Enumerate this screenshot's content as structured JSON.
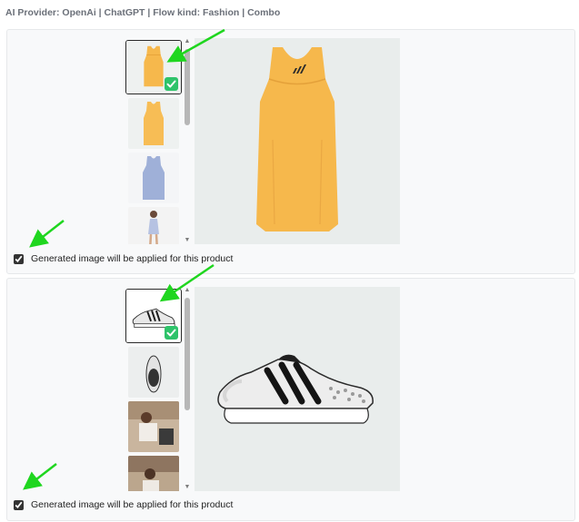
{
  "header": {
    "text": "AI Provider: OpenAi | ChatGPT | Flow kind: Fashion | Combo"
  },
  "products": [
    {
      "apply_label": "Generated image will be applied for this product",
      "apply_checked": true,
      "thumbnails": [
        "dress-yellow-front",
        "dress-yellow-back",
        "dress-blue",
        "dress-model"
      ],
      "selected_index": 0
    },
    {
      "apply_label": "Generated image will be applied for this product",
      "apply_checked": true,
      "thumbnails": [
        "sneaker-side",
        "sneaker-top",
        "lifestyle-photo-1",
        "lifestyle-photo-2"
      ],
      "selected_index": 0
    }
  ],
  "colors": {
    "annotation_arrow": "#1fd61f",
    "check_badge": "#2ec36a",
    "dress_yellow": "#f6b84c",
    "dress_blue": "#9fb0d8"
  },
  "icons": [
    "checkmark-icon",
    "arrow-annotation-icon",
    "scroll-up-icon",
    "scroll-down-icon"
  ]
}
